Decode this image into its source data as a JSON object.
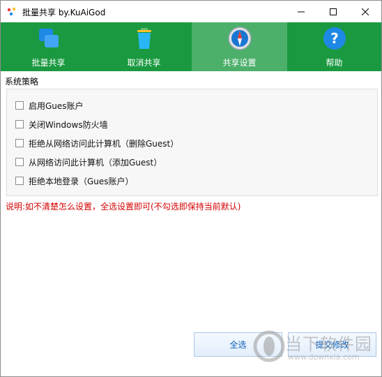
{
  "window": {
    "title": "批量共享  by.KuAiGod",
    "controls": [
      "minimize-icon",
      "maximize-icon",
      "close-icon"
    ]
  },
  "tabs": [
    {
      "label": "批量共享",
      "icon": "share-windows-icon",
      "active": false
    },
    {
      "label": "取消共享",
      "icon": "trash-icon",
      "active": false
    },
    {
      "label": "共享设置",
      "icon": "compass-icon",
      "active": true
    },
    {
      "label": "帮助",
      "icon": "help-icon",
      "active": false
    }
  ],
  "policy": {
    "group_label": "系统策略",
    "options": [
      {
        "label": "启用Gues账户",
        "checked": false
      },
      {
        "label": "关闭Windows防火墙",
        "checked": false
      },
      {
        "label": "拒绝从网络访问此计算机（删除Guest）",
        "checked": false
      },
      {
        "label": "从网络访问此计算机（添加Guest）",
        "checked": false
      },
      {
        "label": "拒绝本地登录（Gues账户）",
        "checked": false
      }
    ]
  },
  "note": "说明:如不清楚怎么设置，全选设置即可(不勾选即保持当前默认)",
  "buttons": {
    "select_all": "全选",
    "submit": "提交修改"
  },
  "watermark": {
    "name": "当下软件园",
    "url": "www.downxia.com"
  },
  "colors": {
    "tab_bar": "#1a9940",
    "tab_active": "#4caf6a",
    "note_text": "#d40000",
    "button_text": "#0b5fb3"
  }
}
